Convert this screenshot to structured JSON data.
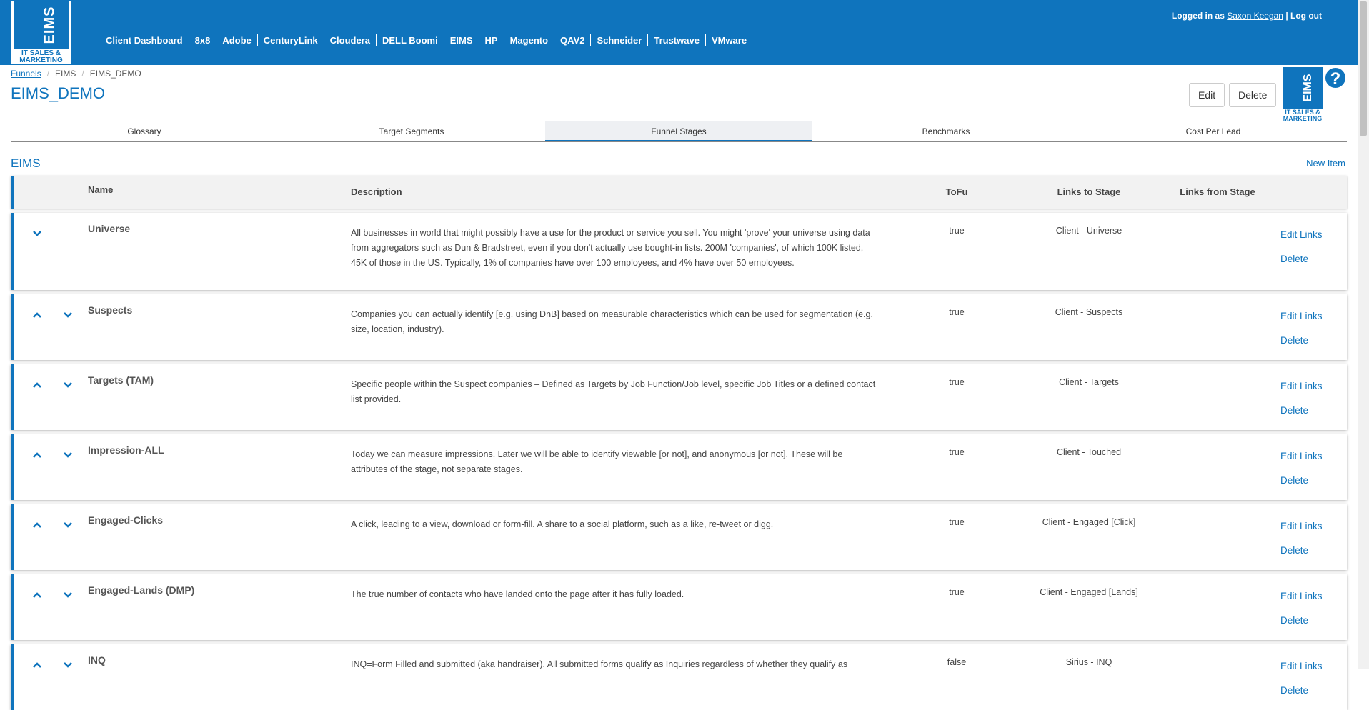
{
  "header": {
    "logo_title": "EIMS",
    "logo_subtitle": "IT SALES & MARKETING",
    "nav": [
      "Client Dashboard",
      "8x8",
      "Adobe",
      "CenturyLink",
      "Cloudera",
      "DELL Boomi",
      "EIMS",
      "HP",
      "Magento",
      "QAV2",
      "Schneider",
      "Trustwave",
      "VMware"
    ],
    "logged_in_prefix": "Logged in as",
    "user": "Saxon Keegan",
    "logout": "| Log out"
  },
  "breadcrumb": {
    "root": "Funnels",
    "client": "EIMS",
    "current": "EIMS_DEMO"
  },
  "page": {
    "title": "EIMS_DEMO",
    "edit": "Edit",
    "delete": "Delete",
    "help": "?"
  },
  "tabs": [
    "Glossary",
    "Target Segments",
    "Funnel Stages",
    "Benchmarks",
    "Cost Per Lead"
  ],
  "active_tab": "Funnel Stages",
  "section": {
    "title": "EIMS",
    "new_item": "New Item"
  },
  "table": {
    "headers": {
      "name": "Name",
      "description": "Description",
      "tofu": "ToFu",
      "links_to": "Links to Stage",
      "links_from": "Links from Stage"
    },
    "edit_links": "Edit Links",
    "delete": "Delete",
    "rows": [
      {
        "name": "Universe",
        "description": "All businesses in world that might possibly have a use for the product or service you sell. You might 'prove' your universe using data from aggregators such as Dun & Bradstreet, even if you don't actually use bought-in lists. 200M 'companies', of which 100K listed, 45K of those in the US. Typically, 1% of companies have over 100 employees, and 4% have over 50 employees.",
        "tofu": "true",
        "links_to": "Client - Universe"
      },
      {
        "name": "Suspects",
        "description": "Companies you can actually identify [e.g. using DnB] based on measurable characteristics which can be used for segmentation (e.g. size, location, industry).",
        "tofu": "true",
        "links_to": "Client - Suspects"
      },
      {
        "name": "Targets (TAM)",
        "description": "Specific people within the Suspect companies – Defined as Targets by Job Function/Job level, specific Job Titles or a defined contact list provided.",
        "tofu": "true",
        "links_to": "Client - Targets"
      },
      {
        "name": "Impression-ALL",
        "description": "Today we can measure impressions. Later we will be able to identify viewable [or not], and anonymous [or not]. These will be attributes of the stage, not separate stages.",
        "tofu": "true",
        "links_to": "Client - Touched"
      },
      {
        "name": "Engaged-Clicks",
        "description": "A click, leading to a view, download or form-fill. A share to a social platform, such as a like, re-tweet or digg.",
        "tofu": "true",
        "links_to": "Client - Engaged [Click]"
      },
      {
        "name": "Engaged-Lands (DMP)",
        "description": "The true number of contacts who have landed onto the page after it has fully loaded.",
        "tofu": "true",
        "links_to": "Client - Engaged [Lands]"
      },
      {
        "name": "INQ",
        "description": "INQ=Form Filled and submitted (aka handraiser). All submitted forms qualify as Inquiries regardless of whether they qualify as",
        "tofu": "false",
        "links_to": "Sirius - INQ"
      }
    ]
  }
}
